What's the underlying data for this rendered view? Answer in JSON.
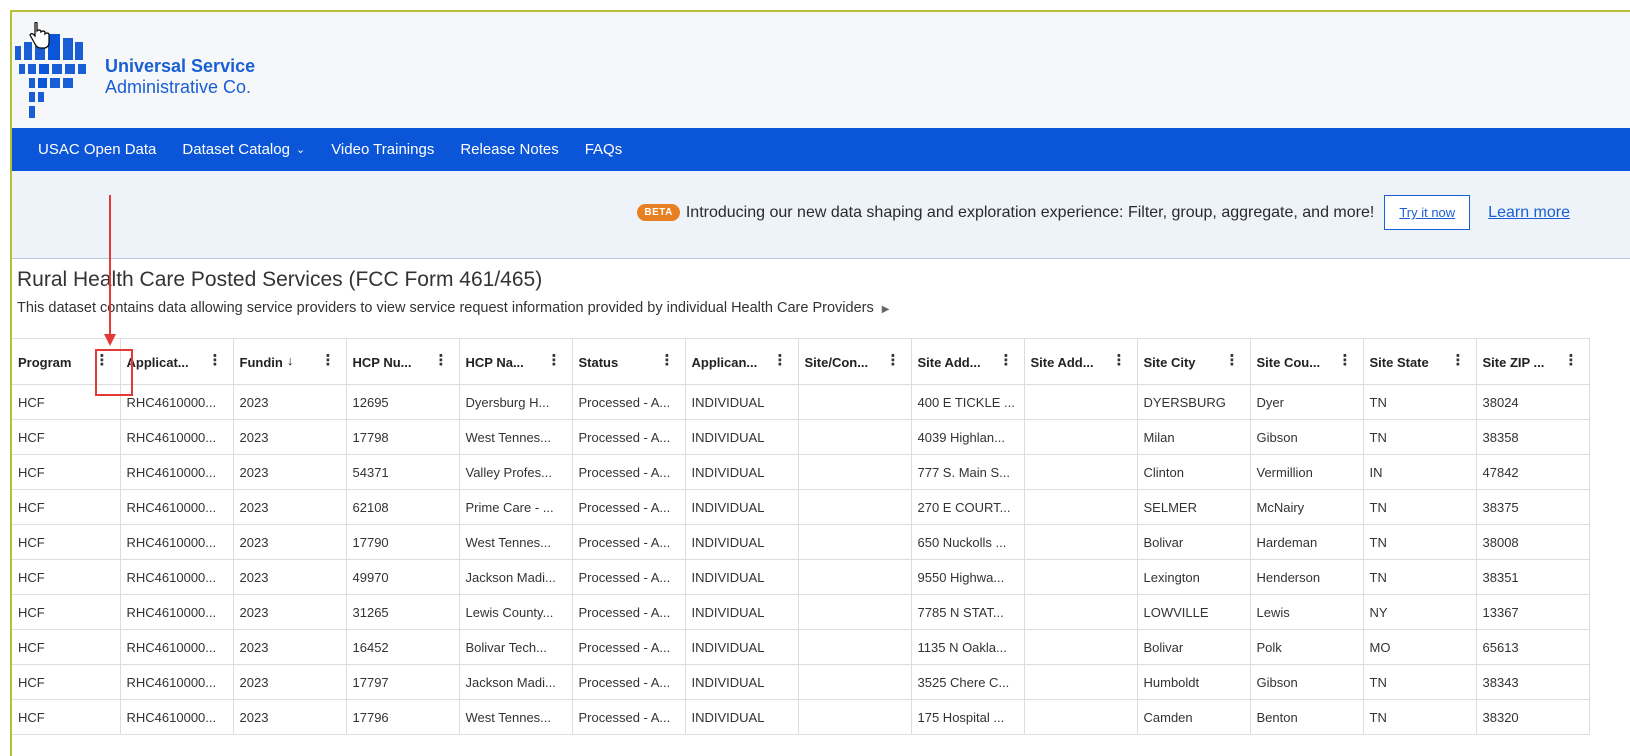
{
  "brand": {
    "line1": "Universal Service",
    "line2": "Administrative Co.",
    "accent": "#1a5ed6"
  },
  "nav": {
    "items": [
      {
        "label": "USAC Open Data"
      },
      {
        "label": "Dataset Catalog",
        "has_dropdown": true
      },
      {
        "label": "Video Trainings"
      },
      {
        "label": "Release Notes"
      },
      {
        "label": "FAQs"
      }
    ],
    "background": "#0b55d8"
  },
  "banner": {
    "badge": "BETA",
    "text": "Introducing our new data shaping and exploration experience: Filter, group, aggregate, and more!",
    "try_label": "Try it now",
    "learn_label": "Learn more"
  },
  "dataset": {
    "title": "Rural Health Care Posted Services (FCC Form 461/465)",
    "description": "This dataset contains data allowing service providers to view service request information provided by individual Health Care Providers"
  },
  "table": {
    "columns": [
      {
        "label": "Program"
      },
      {
        "label": "Applicat..."
      },
      {
        "label": "Fundin",
        "sorted": "desc"
      },
      {
        "label": "HCP Nu..."
      },
      {
        "label": "HCP Na..."
      },
      {
        "label": "Status"
      },
      {
        "label": "Applican..."
      },
      {
        "label": "Site/Con..."
      },
      {
        "label": "Site Add..."
      },
      {
        "label": "Site Add..."
      },
      {
        "label": "Site City"
      },
      {
        "label": "Site Cou..."
      },
      {
        "label": "Site State"
      },
      {
        "label": "Site ZIP ..."
      }
    ],
    "rows": [
      [
        "HCF",
        "RHC4610000...",
        "2023",
        "12695",
        "Dyersburg H...",
        "Processed - A...",
        "INDIVIDUAL",
        "",
        "400 E TICKLE ...",
        "",
        "DYERSBURG",
        "Dyer",
        "TN",
        "38024"
      ],
      [
        "HCF",
        "RHC4610000...",
        "2023",
        "17798",
        "West Tennes...",
        "Processed - A...",
        "INDIVIDUAL",
        "",
        "4039 Highlan...",
        "",
        "Milan",
        "Gibson",
        "TN",
        "38358"
      ],
      [
        "HCF",
        "RHC4610000...",
        "2023",
        "54371",
        "Valley Profes...",
        "Processed - A...",
        "INDIVIDUAL",
        "",
        "777 S. Main S...",
        "",
        "Clinton",
        "Vermillion",
        "IN",
        "47842"
      ],
      [
        "HCF",
        "RHC4610000...",
        "2023",
        "62108",
        "Prime Care - ...",
        "Processed - A...",
        "INDIVIDUAL",
        "",
        "270 E COURT...",
        "",
        "SELMER",
        "McNairy",
        "TN",
        "38375"
      ],
      [
        "HCF",
        "RHC4610000...",
        "2023",
        "17790",
        "West Tennes...",
        "Processed - A...",
        "INDIVIDUAL",
        "",
        "650 Nuckolls ...",
        "",
        "Bolivar",
        "Hardeman",
        "TN",
        "38008"
      ],
      [
        "HCF",
        "RHC4610000...",
        "2023",
        "49970",
        "Jackson Madi...",
        "Processed - A...",
        "INDIVIDUAL",
        "",
        "9550 Highwa...",
        "",
        "Lexington",
        "Henderson",
        "TN",
        "38351"
      ],
      [
        "HCF",
        "RHC4610000...",
        "2023",
        "31265",
        "Lewis County...",
        "Processed - A...",
        "INDIVIDUAL",
        "",
        "7785 N STAT...",
        "",
        "LOWVILLE",
        "Lewis",
        "NY",
        "13367"
      ],
      [
        "HCF",
        "RHC4610000...",
        "2023",
        "16452",
        "Bolivar Tech...",
        "Processed - A...",
        "INDIVIDUAL",
        "",
        "1135 N Oakla...",
        "",
        "Bolivar",
        "Polk",
        "MO",
        "65613"
      ],
      [
        "HCF",
        "RHC4610000...",
        "2023",
        "17797",
        "Jackson Madi...",
        "Processed - A...",
        "INDIVIDUAL",
        "",
        "3525 Chere C...",
        "",
        "Humboldt",
        "Gibson",
        "TN",
        "38343"
      ],
      [
        "HCF",
        "RHC4610000...",
        "2023",
        "17796",
        "West Tennes...",
        "Processed - A...",
        "INDIVIDUAL",
        "",
        "175 Hospital ...",
        "",
        "Camden",
        "Benton",
        "TN",
        "38320"
      ]
    ]
  },
  "annotation": {
    "color": "#e53935"
  }
}
